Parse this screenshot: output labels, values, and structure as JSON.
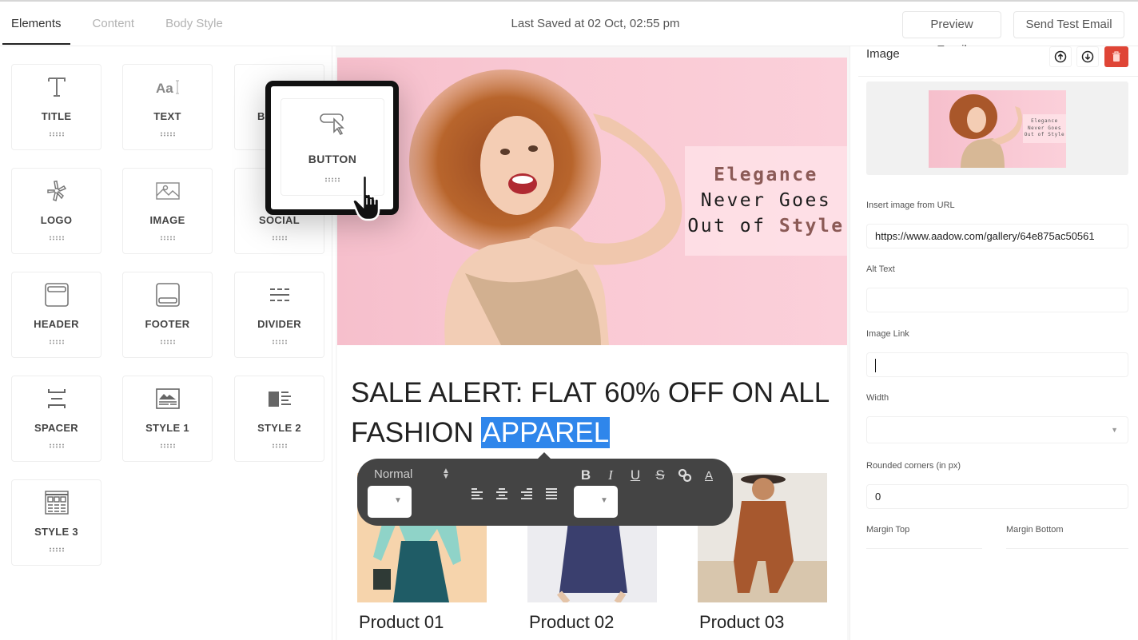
{
  "topbar": {
    "tabs": [
      {
        "label": "Elements",
        "active": true
      },
      {
        "label": "Content",
        "active": false
      },
      {
        "label": "Body Style",
        "active": false
      }
    ],
    "last_saved": "Last Saved at 02 Oct, 02:55 pm",
    "preview_label": "Preview Email",
    "send_test_label": "Send Test Email"
  },
  "elements": {
    "tiles": [
      {
        "label": "TITLE",
        "icon": "title-icon"
      },
      {
        "label": "TEXT",
        "icon": "text-icon"
      },
      {
        "label": "BUTTON",
        "icon": "button-icon"
      },
      {
        "label": "LOGO",
        "icon": "logo-icon"
      },
      {
        "label": "IMAGE",
        "icon": "image-icon"
      },
      {
        "label": "SOCIAL",
        "icon": "social-icon"
      },
      {
        "label": "HEADER",
        "icon": "header-icon"
      },
      {
        "label": "FOOTER",
        "icon": "footer-icon"
      },
      {
        "label": "DIVIDER",
        "icon": "divider-icon"
      },
      {
        "label": "SPACER",
        "icon": "spacer-icon"
      },
      {
        "label": "STYLE 1",
        "icon": "style1-icon"
      },
      {
        "label": "STYLE 2",
        "icon": "style2-icon"
      },
      {
        "label": "STYLE 3",
        "icon": "style3-icon"
      }
    ],
    "dragging": {
      "label": "BUTTON",
      "icon": "button-icon"
    }
  },
  "email": {
    "hero": {
      "line1": "Elegance",
      "line2": "Never Goes",
      "line3_prefix": "Out of ",
      "line3_accent": "Style"
    },
    "headline_before": "SALE ALERT: FLAT 60% OFF ON ALL FASHION ",
    "headline_selected": "APPAREL",
    "products": [
      {
        "name": "Product 01"
      },
      {
        "name": "Product 02"
      },
      {
        "name": "Product 03"
      }
    ]
  },
  "text_toolbar": {
    "format_value": "Normal",
    "font_select_value": "",
    "size_select_value": "",
    "buttons": [
      "bold",
      "italic",
      "underline",
      "strikethrough",
      "link",
      "text-color"
    ],
    "align": [
      "left",
      "center",
      "right",
      "justify"
    ]
  },
  "properties": {
    "title": "Image",
    "delete_color": "#df4536",
    "preview_text": {
      "line1": "Elegance",
      "line2": "Never Goes",
      "line3": "Out of Style"
    },
    "fields": {
      "url_label": "Insert image from URL",
      "url_value": "https://www.aadow.com/gallery/64e875ac50561",
      "alt_label": "Alt Text",
      "alt_value": "",
      "link_label": "Image Link",
      "link_value": "",
      "width_label": "Width",
      "width_value": "",
      "corners_label": "Rounded corners (in px)",
      "corners_value": "0",
      "margin_top_label": "Margin Top",
      "margin_bottom_label": "Margin Bottom"
    }
  },
  "colors": {
    "selection": "#2f86eb",
    "toolbar_bg": "#444444",
    "hero_pink": "#f8c6d1",
    "hero_accent": "#8b5a56"
  }
}
